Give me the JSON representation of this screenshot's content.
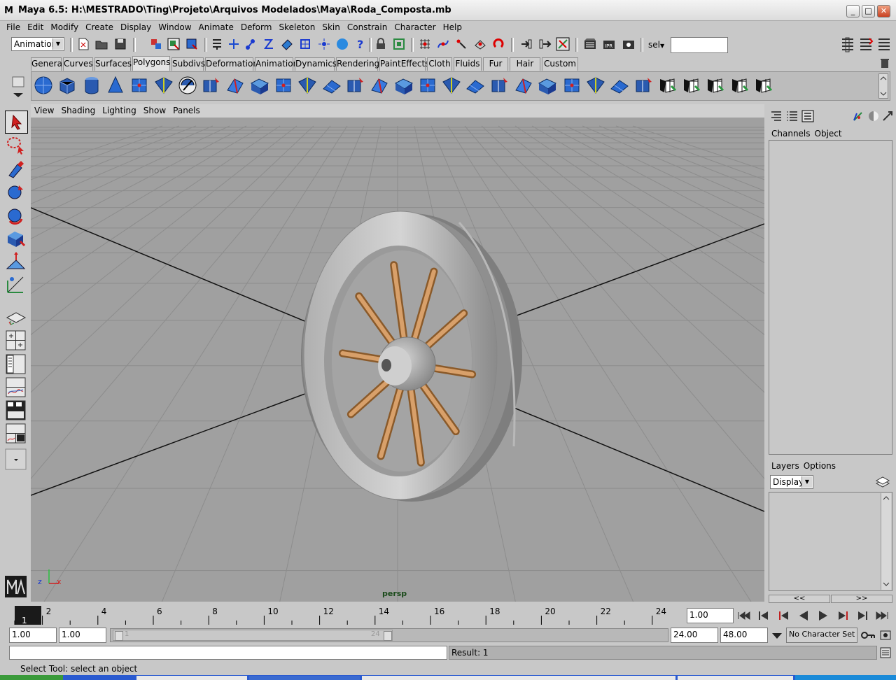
{
  "window": {
    "icon_letter": "M",
    "title": "Maya 6.5: H:\\MESTRADO\\Ting\\Projeto\\Arquivos Modelados\\Maya\\Roda_Composta.mb",
    "min": "_",
    "max": "□",
    "close": "✕"
  },
  "menubar": [
    "File",
    "Edit",
    "Modify",
    "Create",
    "Display",
    "Window",
    "Animate",
    "Deform",
    "Skeleton",
    "Skin",
    "Constrain",
    "Character",
    "Help"
  ],
  "statusline": {
    "menuset": "Animation",
    "sel_label": "sel",
    "sel_value": ""
  },
  "shelf": {
    "tabs": [
      "General",
      "Curves",
      "Surfaces",
      "Polygons",
      "Subdivs",
      "Deformation",
      "Animation",
      "Dynamics",
      "Rendering",
      "PaintEffects",
      "Cloth",
      "Fluids",
      "Fur",
      "Hair",
      "Custom"
    ],
    "active": "Polygons"
  },
  "viewport": {
    "menu": [
      "View",
      "Shading",
      "Lighting",
      "Show",
      "Panels"
    ],
    "camera": "persp",
    "axis_z": "z",
    "axis_x": "x"
  },
  "channelbox": {
    "menu": [
      "Channels",
      "Object"
    ]
  },
  "layers": {
    "menu": [
      "Layers",
      "Options"
    ],
    "display": "Display",
    "nav_left": "<<",
    "nav_right": ">>"
  },
  "timeline": {
    "current_frame": "1",
    "ticks": [
      "2",
      "4",
      "6",
      "8",
      "10",
      "12",
      "14",
      "16",
      "18",
      "20",
      "22",
      "24"
    ],
    "current_time": "1.00"
  },
  "range": {
    "start": "1.00",
    "playback_start": "1.00",
    "handle_start": "1",
    "handle_end": "24",
    "playback_end": "24.00",
    "end": "48.00",
    "character_set": "No Character Set"
  },
  "commandline": {
    "value": "",
    "result": "Result: 1"
  },
  "helpline": "Select Tool: select an object",
  "colors": {
    "viewport": "#a0a0a0",
    "spoke": "#c8905a",
    "rim": "#9a9a9a"
  }
}
